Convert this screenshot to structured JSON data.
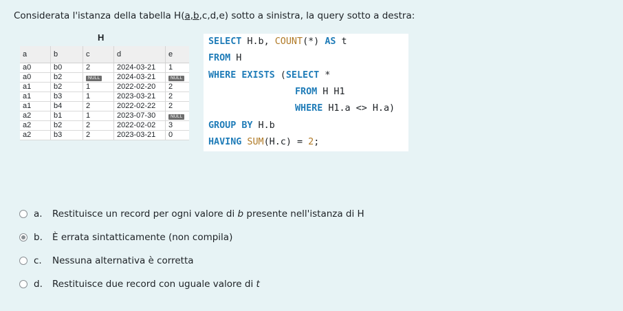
{
  "question": {
    "text_prefix": "Considerata l'istanza della tabella H(",
    "text_key": "a,b",
    "text_suffix": ",c,d,e) sotto a sinistra, la query sotto a destra:"
  },
  "table": {
    "title": "H",
    "columns": [
      "a",
      "b",
      "c",
      "d",
      "e"
    ],
    "null_label": "NULL",
    "rows": [
      [
        "a0",
        "b0",
        "2",
        "2024-03-21",
        "1"
      ],
      [
        "a0",
        "b2",
        "NULL",
        "2024-03-21",
        "NULL"
      ],
      [
        "a1",
        "b2",
        "1",
        "2022-02-20",
        "2"
      ],
      [
        "a1",
        "b3",
        "1",
        "2023-03-21",
        "2"
      ],
      [
        "a1",
        "b4",
        "2",
        "2022-02-22",
        "2"
      ],
      [
        "a2",
        "b1",
        "1",
        "2023-07-30",
        "NULL"
      ],
      [
        "a2",
        "b2",
        "2",
        "2022-02-02",
        "3"
      ],
      [
        "a2",
        "b3",
        "2",
        "2023-03-21",
        "0"
      ]
    ]
  },
  "sql": {
    "l1_kw": "SELECT",
    "l1_a": " H.b, ",
    "l1_fn": "COUNT",
    "l1_b": "(*) ",
    "l1_kw2": "AS",
    "l1_c": " t",
    "l2_kw": "FROM",
    "l2_a": " H",
    "l3_kw": "WHERE EXISTS",
    "l3_a": " (",
    "l3_kw2": "SELECT",
    "l3_b": " *",
    "l4_kw": "FROM",
    "l4_a": " H H1",
    "l5_kw": "WHERE",
    "l5_a": " H1.a <> H.a)",
    "l6_kw": "GROUP BY",
    "l6_a": " H.b",
    "l7_kw": "HAVING",
    "l7_fn": " SUM",
    "l7_a": "(H.c) = ",
    "l7_num": "2",
    "l7_b": ";"
  },
  "options": [
    {
      "letter": "a.",
      "text_before": "Restituisce un record per ogni valore di ",
      "text_italic": "b",
      "text_after": " presente nell'istanza di H",
      "selected": false
    },
    {
      "letter": "b.",
      "text_before": "È errata sintatticamente (non compila)",
      "text_italic": "",
      "text_after": "",
      "selected": true
    },
    {
      "letter": "c.",
      "text_before": "Nessuna alternativa è corretta",
      "text_italic": "",
      "text_after": "",
      "selected": false
    },
    {
      "letter": "d.",
      "text_before": "Restituisce due record con uguale valore di ",
      "text_italic": "t",
      "text_after": "",
      "selected": false
    }
  ]
}
